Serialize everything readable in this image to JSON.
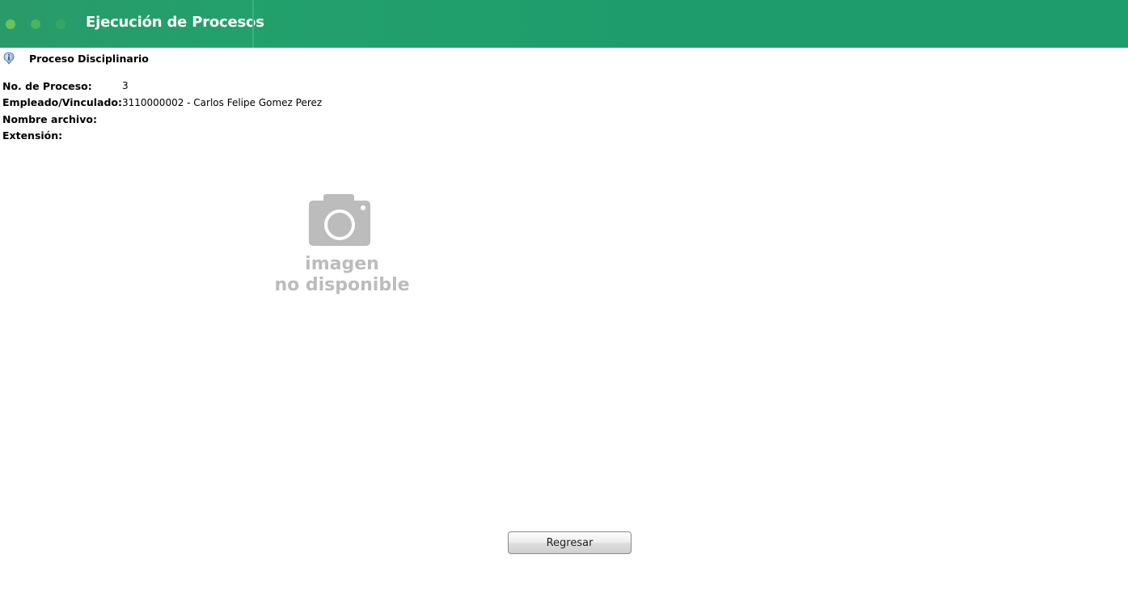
{
  "header": {
    "title": "Ejecución de Procesos"
  },
  "section": {
    "title": "Proceso Disciplinario",
    "icon": "info-icon"
  },
  "fields": [
    {
      "label": "No. de Proceso:",
      "value": "3"
    },
    {
      "label": "Empleado/Vinculado:",
      "value": "3110000002 - Carlos Felipe Gomez Perez"
    },
    {
      "label": "Nombre archivo:",
      "value": ""
    },
    {
      "label": "Extensión:",
      "value": ""
    }
  ],
  "placeholder_image": {
    "icon": "camera-icon",
    "line1": "imagen",
    "line2": "no disponible"
  },
  "buttons": {
    "back_label": "Regresar"
  },
  "colors": {
    "header_bg": "#1e9c6b",
    "placeholder_gray": "#bcbcbc"
  }
}
